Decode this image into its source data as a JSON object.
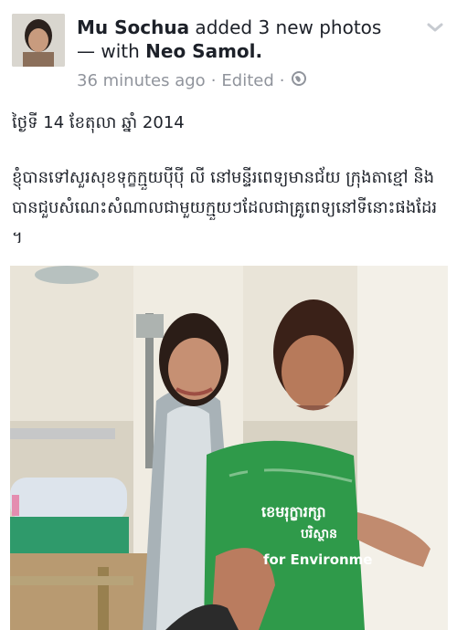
{
  "post": {
    "author": "Mu Sochua",
    "action": " added 3 new photos",
    "with_prefix": "— with ",
    "tagged": "Neo Samol.",
    "time": "36 minutes ago",
    "edited": "Edited",
    "separator": "·",
    "date_line": "ថ្ងៃទី 14 ខែតុលា ឆ្នាំ 2014",
    "body": "ខ្ញុំបានទៅសួរសុខទុក្ខក្មួយប៉ីប៉ី លី នៅមន្ទីរពេទ្យមានជ័យ ក្រុងតាខ្មៅ និងបានជួបសំណេះសំណាលជាមួយក្មួយៗដែលជាគ្រូពេទ្យនៅទីនោះផងដែរ ។",
    "shirt_text_1": "ខេមរុក្ខារក្សា",
    "shirt_text_2": "បរិស្ថាន",
    "shirt_text_3": "for Environme"
  },
  "icons": {
    "privacy": "globe-icon",
    "menu": "chevron-down-icon"
  },
  "colors": {
    "meta": "#90949c",
    "text": "#1d2129",
    "shirt": "#2f9a4a"
  }
}
